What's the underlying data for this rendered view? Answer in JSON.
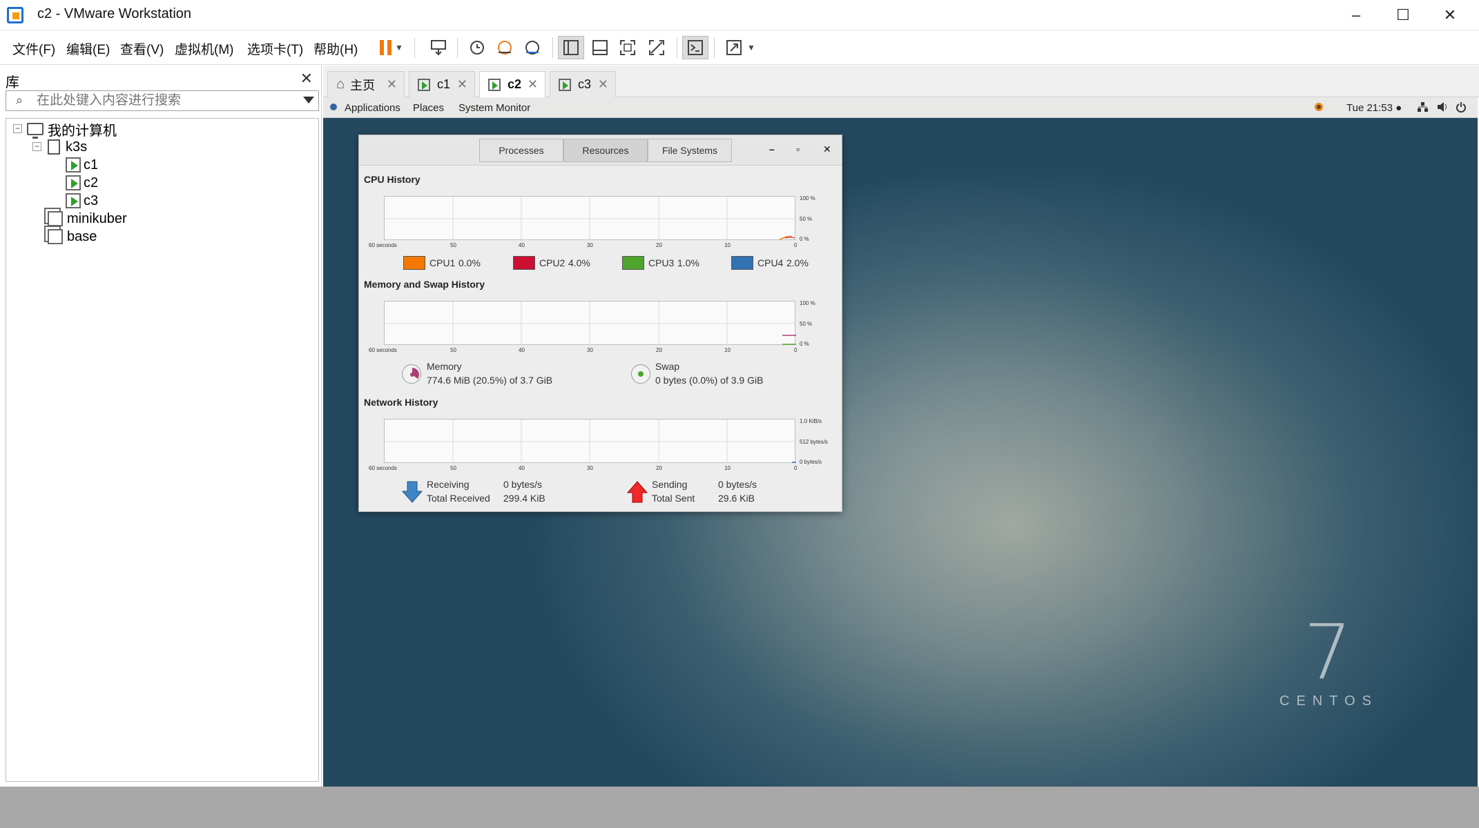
{
  "window": {
    "title": "c2 - VMware Workstation",
    "minimize": "–",
    "maximize": "☐",
    "close": "✕"
  },
  "menu": [
    "文件(F)",
    "编辑(E)",
    "查看(V)",
    "虚拟机(M)",
    "选项卡(T)",
    "帮助(H)"
  ],
  "library": {
    "title": "库",
    "close": "✕",
    "search_placeholder": "在此处键入内容进行搜索",
    "tree": {
      "root": "我的计算机",
      "folder": "k3s",
      "vms": [
        "c1",
        "c2",
        "c3"
      ],
      "others": [
        "minikuber",
        "base"
      ]
    }
  },
  "tabs": [
    {
      "label": "主页",
      "icon": "home-icon"
    },
    {
      "label": "c1",
      "icon": "vm-running-icon"
    },
    {
      "label": "c2",
      "icon": "vm-running-icon",
      "active": true
    },
    {
      "label": "c3",
      "icon": "vm-running-icon"
    }
  ],
  "tab_close": "✕",
  "gnome": {
    "applications": "Applications",
    "places": "Places",
    "system_monitor": "System Monitor",
    "clock": "Tue 21:53 ●"
  },
  "sysmon": {
    "tabs": [
      "Processes",
      "Resources",
      "File Systems"
    ],
    "selected_tab": "Resources",
    "wbtns": {
      "minimize": "–",
      "maximize": "▫",
      "close": "✕"
    },
    "cpu": {
      "title": "CPU History",
      "y_ticks": [
        "100 %",
        "50 %",
        "0 %"
      ],
      "x_ticks": [
        "60 seconds",
        "50",
        "40",
        "30",
        "20",
        "10",
        "0"
      ],
      "cores": [
        {
          "name": "CPU1",
          "value": "0.0%",
          "color": "#f57900"
        },
        {
          "name": "CPU2",
          "value": "4.0%",
          "color": "#cc0f30"
        },
        {
          "name": "CPU3",
          "value": "1.0%",
          "color": "#4ea52b"
        },
        {
          "name": "CPU4",
          "value": "2.0%",
          "color": "#3473b3"
        }
      ]
    },
    "memory": {
      "title": "Memory and Swap History",
      "y_ticks": [
        "100 %",
        "50 %",
        "0 %"
      ],
      "x_ticks": [
        "60 seconds",
        "50",
        "40",
        "30",
        "20",
        "10",
        "0"
      ],
      "mem_label": "Memory",
      "mem_value": "774.6 MiB (20.5%) of 3.7 GiB",
      "swap_label": "Swap",
      "swap_value": "0 bytes (0.0%) of 3.9 GiB",
      "mem_color": "#ad3d76",
      "swap_color": "#4ea52b"
    },
    "network": {
      "title": "Network History",
      "y_ticks": [
        "1.0 KiB/s",
        "512 bytes/s",
        "0 bytes/s"
      ],
      "x_ticks": [
        "60 seconds",
        "50",
        "40",
        "30",
        "20",
        "10",
        "0"
      ],
      "receiving_label": "Receiving",
      "receiving_value": "0 bytes/s",
      "total_received_label": "Total Received",
      "total_received_value": "299.4 KiB",
      "sending_label": "Sending",
      "sending_value": "0 bytes/s",
      "total_sent_label": "Total Sent",
      "total_sent_value": "29.6 KiB"
    }
  },
  "desktop": {
    "version": "7",
    "brand": "CENTOS"
  }
}
